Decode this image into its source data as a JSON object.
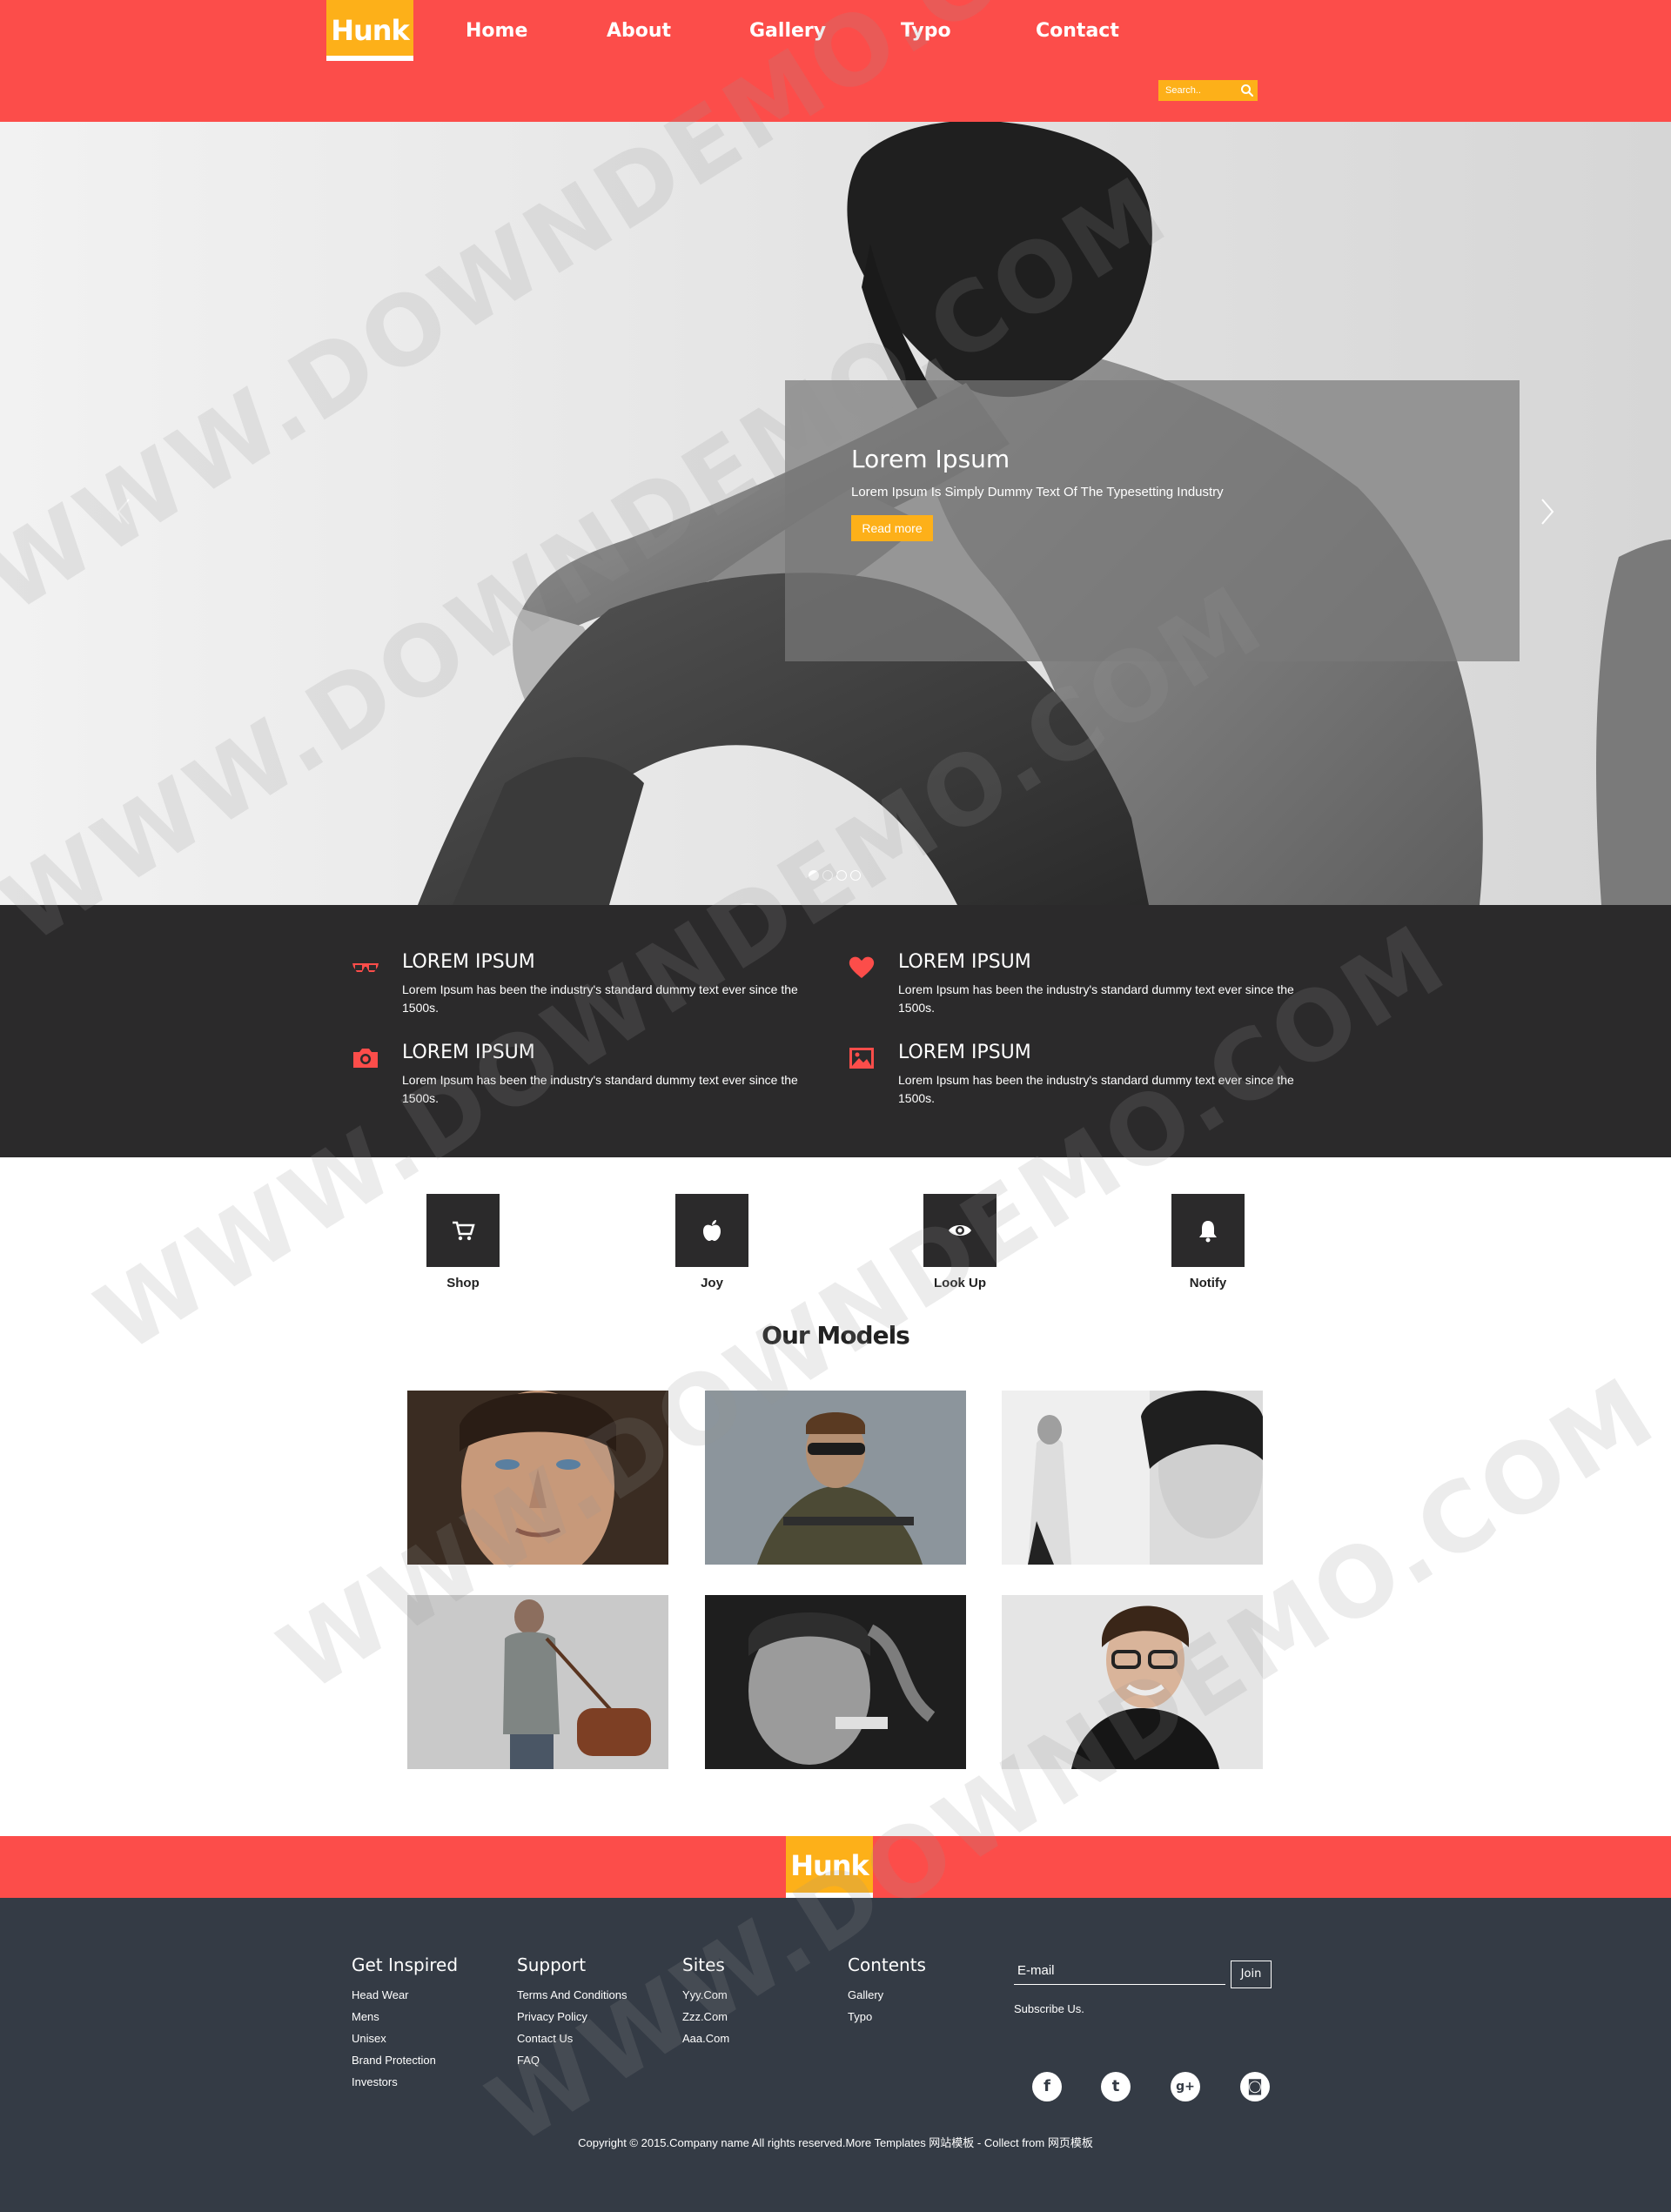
{
  "header": {
    "logo": "Hunk",
    "nav": [
      "Home",
      "About",
      "Gallery",
      "Typo",
      "Contact"
    ],
    "search_placeholder": "Search..",
    "search_icon": "search-icon"
  },
  "hero": {
    "caption_title": "Lorem Ipsum",
    "caption_text": "Lorem Ipsum Is Simply Dummy Text Of The Typesetting Industry",
    "read_more": "Read more",
    "slides_total": 4,
    "active_slide": 1
  },
  "features": [
    {
      "icon": "glasses-icon",
      "title": "LOREM IPSUM",
      "text": "Lorem Ipsum has been the industry's standard dummy text ever since the 1500s."
    },
    {
      "icon": "heart-icon",
      "title": "LOREM IPSUM",
      "text": "Lorem Ipsum has been the industry's standard dummy text ever since the 1500s."
    },
    {
      "icon": "camera-icon",
      "title": "LOREM IPSUM",
      "text": "Lorem Ipsum has been the industry's standard dummy text ever since the 1500s."
    },
    {
      "icon": "picture-icon",
      "title": "LOREM IPSUM",
      "text": "Lorem Ipsum has been the industry's standard dummy text ever since the 1500s."
    }
  ],
  "services": [
    {
      "icon": "cart-icon",
      "label": "Shop"
    },
    {
      "icon": "apple-icon",
      "label": "Joy"
    },
    {
      "icon": "eye-icon",
      "label": "Look Up"
    },
    {
      "icon": "bell-icon",
      "label": "Notify"
    }
  ],
  "models": {
    "title": "Our Models"
  },
  "footer": {
    "logo": "Hunk",
    "columns": [
      {
        "title": "Get Inspired",
        "links": [
          "Head Wear",
          "Mens",
          "Unisex",
          "Brand Protection",
          "Investors"
        ]
      },
      {
        "title": "Support",
        "links": [
          "Terms And Conditions",
          "Privacy Policy",
          "Contact Us",
          "FAQ"
        ]
      },
      {
        "title": "Sites",
        "links": [
          "Yyy.Com",
          "Zzz.Com",
          "Aaa.Com"
        ]
      },
      {
        "title": "Contents",
        "links": [
          "Gallery",
          "Typo"
        ]
      }
    ],
    "email_placeholder": "E-mail",
    "join": "Join",
    "subscribe": "Subscribe Us.",
    "social": [
      {
        "icon": "facebook-icon",
        "glyph": "f"
      },
      {
        "icon": "twitter-icon",
        "glyph": "t"
      },
      {
        "icon": "google-plus-icon",
        "glyph": "g+"
      },
      {
        "icon": "instagram-icon",
        "glyph": "◙"
      }
    ],
    "copyright": "Copyright © 2015.Company name All rights reserved.More Templates 网站模板 - Collect from 网页模板"
  },
  "watermark": "WWW.DOWNDEMO.COM",
  "colors": {
    "primary": "#fc4d4a",
    "accent": "#fdb019",
    "dark": "#2b2a2b",
    "footer": "#343b45"
  }
}
